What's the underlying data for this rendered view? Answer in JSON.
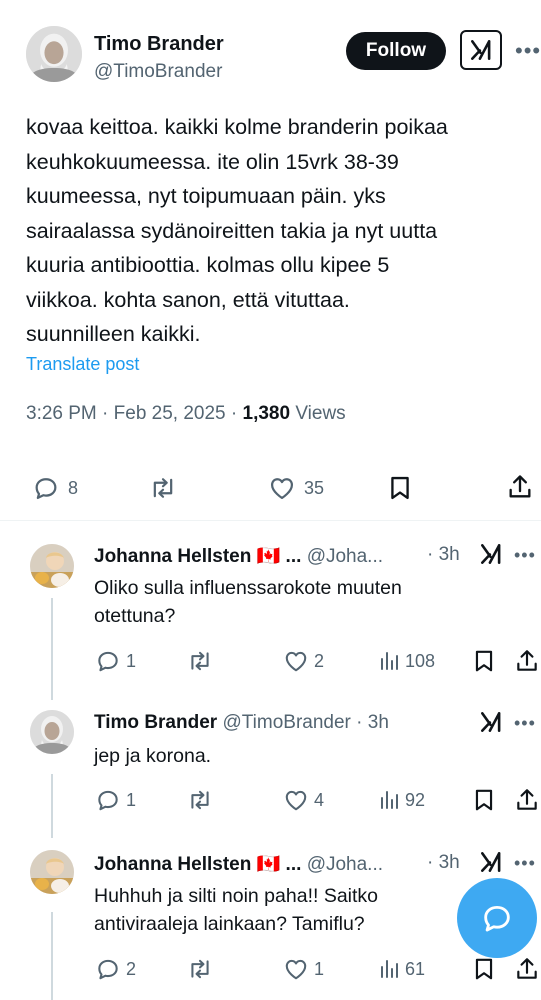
{
  "post": {
    "author_name": "Timo Brander",
    "author_handle": "@TimoBrander",
    "follow_label": "Follow",
    "text": "kovaa keittoa. kaikki kolme branderin poikaa\nkeuhkokuumeessa. ite olin 15vrk 38-39\nkuumeessa, nyt toipumuaan päin. yks\nsairaalassa sydänoireitten takia ja nyt uutta\nkuuria antibioottia. kolmas ollu kipee 5\nviikkoa. kohta sanon, että vituttaa.\nsuunnilleen kaikki.",
    "translate_label": "Translate post",
    "time": "3:26 PM · Feb 25, 2025 · ",
    "views_count": "1,380",
    "views_label": " Views",
    "replies": "8",
    "likes": "35"
  },
  "replies": [
    {
      "name": "Johanna Hellsten",
      "flag": "🇨🇦",
      "ellipsis": " ...",
      "handle": "@Joha...",
      "time": "· 3h",
      "text": "Oliko sulla influenssarokote muuten otettuna?",
      "replies": "1",
      "likes": "2",
      "views": "108"
    },
    {
      "name": "Timo Brander",
      "handle": "@TimoBrander",
      "time": "· 3h",
      "text": "jep ja korona.",
      "replies": "1",
      "likes": "4",
      "views": "92"
    },
    {
      "name": "Johanna Hellsten",
      "flag": "🇨🇦",
      "ellipsis": " ...",
      "handle": "@Joha...",
      "time": "· 3h",
      "text": "Huhhuh ja silti noin paha!! Saitko antiviraaleja lainkaan? Tamiflu?",
      "replies": "2",
      "likes": "1",
      "views": "61"
    }
  ],
  "icons": {
    "more": "more-icon",
    "grok": "grok-icon",
    "reply": "reply-icon",
    "retweet": "retweet-icon",
    "like": "heart-icon",
    "views": "views-icon",
    "bookmark": "bookmark-icon",
    "share": "share-icon",
    "compose": "compose-reply-icon"
  },
  "colors": {
    "accent": "#1d9bf0",
    "text": "#0f1419",
    "secondary": "#536471"
  }
}
